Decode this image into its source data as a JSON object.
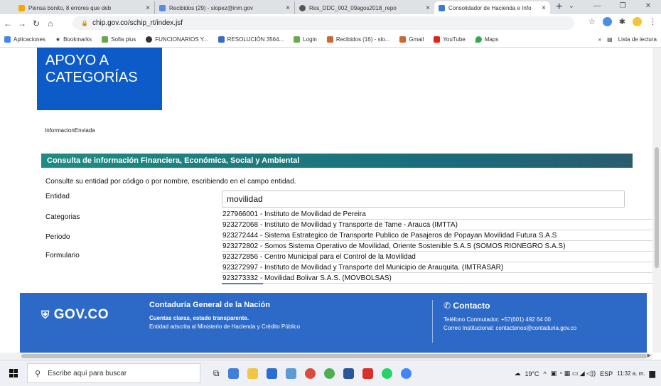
{
  "browser": {
    "tabs": [
      {
        "title": "Piensa bonito, 8 errores que deb",
        "favicon_color": "#f2a900"
      },
      {
        "title": "Recibidos (29) - slopez@inm.gov",
        "favicon_color": "#5b8bd9"
      },
      {
        "title": "Res_DDC_002_09agos2018_repo",
        "favicon_color": "#555555"
      },
      {
        "title": "Consolidador de Hacienda e Info",
        "favicon_color": "#3a7bd5",
        "active": true
      }
    ],
    "close_glyph": "×",
    "new_tab_glyph": "+",
    "url": "chip.gov.co/schip_rt/index.jsf",
    "bookmarks": [
      {
        "label": "Aplicaciones",
        "icon_color": "#4285f4"
      },
      {
        "label": "Bookmarks",
        "icon_color": "#202124"
      },
      {
        "label": "Sofia plus",
        "icon_color": "#6aa84f"
      },
      {
        "label": "FUNCIONARIOS Y...",
        "icon_color": "#333333"
      },
      {
        "label": "RESOLUCIÓN 3564...",
        "icon_color": "#3b6bc8"
      },
      {
        "label": "Login",
        "icon_color": "#6aa84f"
      },
      {
        "label": "Recibidos (16) - slo...",
        "icon_color": "#cc6633"
      },
      {
        "label": "Gmail",
        "icon_color": "#cc6633"
      },
      {
        "label": "YouTube",
        "icon_color": "#e62117"
      },
      {
        "label": "Maps",
        "icon_color": "#34a853"
      }
    ],
    "bookmarks_overflow": "»",
    "reading_list": "Lista de lectura"
  },
  "page": {
    "category_box": "APOYO A CATEGORÍAS",
    "info_enviada": "InformacionEnviada",
    "section_title": "Consulta de información Financiera, Económica, Social y Ambiental",
    "instructions": "Consulte su entidad por código o por nombre, escribiendo en el campo entidad.",
    "labels": {
      "entidad": "Entidad",
      "categorias": "Categorias",
      "periodo": "Periodo",
      "formulario": "Formulario"
    },
    "entity_input_value": "movilidad",
    "suggestions": [
      "227966001 - Instituto de Movilidad de Pereira",
      "923272068 - Instituto de Movilidad y Transporte de Tame - Arauca (IMTTA)",
      "923272444 - Sistema Estrategico de Transporte Publico de Pasajeros de Popayan Movilidad Futura S.A.S",
      "923272802 - Somos Sistema Operativo de Movilidad, Oriente Sostenible S.A.S (SOMOS RIONEGRO S.A.S)",
      "923272856 - Centro Municipal para el Control de la Movilidad",
      "923272997 - Instituto de Movilidad y Transporte del Municipio de Arauquita. (IMTRASAR)",
      "923273332 - Movilidad Bolivar S.A.S. (MOVBOLSAS)"
    ],
    "footer": {
      "logo_text": "GOV.CO",
      "cgn_title": "Contaduría General de la Nación",
      "cgn_slogan": "Cuentas claras, estado transparente.",
      "cgn_desc": "Entidad adscrita al Ministerio de Hacienda y Crédito Público",
      "contact_title": "Contacto",
      "phone": "Teléfono Conmutador: +57(601) 492 64 00",
      "email": "Correo Institucional: contactenos@contaduria.gov.co"
    }
  },
  "taskbar": {
    "search_placeholder": "Escribe aquí para buscar",
    "weather": "19°C",
    "language": "ESP",
    "time": "11:32 a. m."
  },
  "colors": {
    "accent_blue": "#0c5bc9",
    "section_teal": "#1e8c82",
    "footer_blue": "#2d69c6"
  }
}
